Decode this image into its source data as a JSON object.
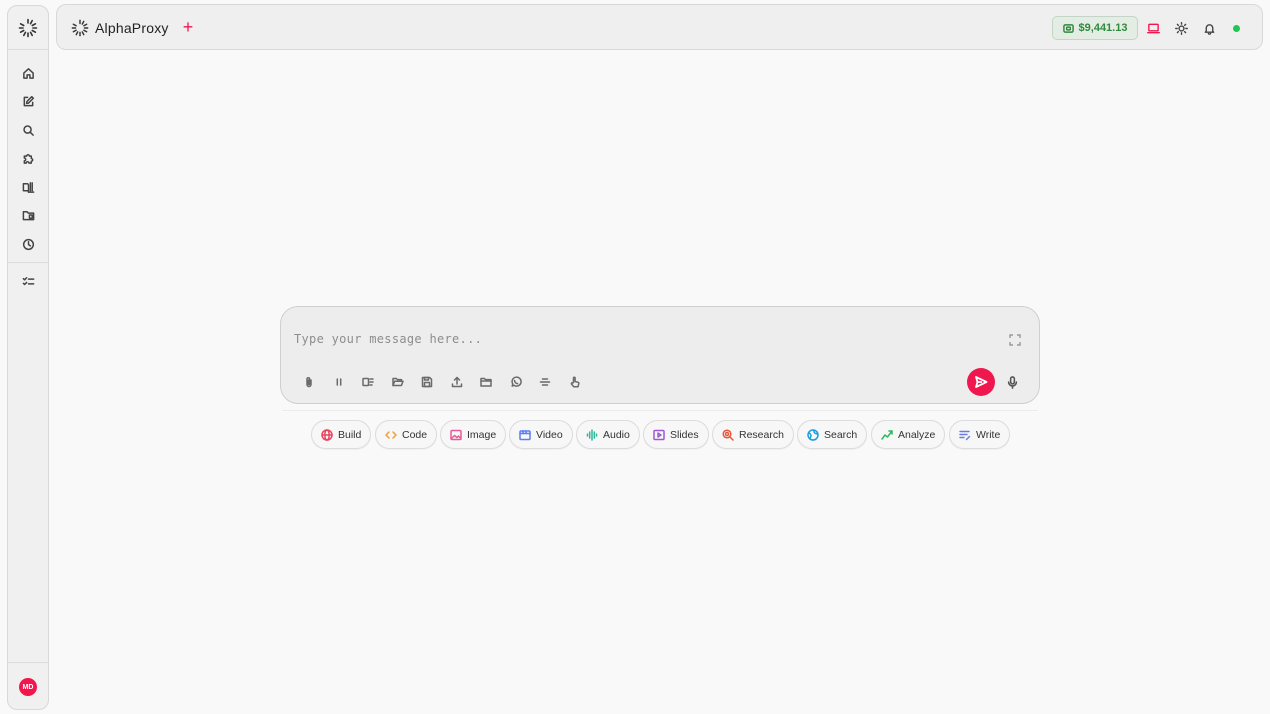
{
  "app": {
    "name": "AlphaProxy",
    "new_label": "+"
  },
  "header": {
    "balance": "$9,441.13"
  },
  "sidebar": {
    "items": [
      {
        "icon": "home-icon"
      },
      {
        "icon": "edit-icon"
      },
      {
        "icon": "search-icon"
      },
      {
        "icon": "puzzle-icon"
      },
      {
        "icon": "library-icon"
      },
      {
        "icon": "folder-icon"
      },
      {
        "icon": "history-icon"
      },
      {
        "icon": "tasks-icon"
      }
    ],
    "avatar": "MD"
  },
  "composer": {
    "placeholder": "Type your message here..."
  },
  "chips": [
    {
      "label": "Build",
      "icon": "globe-icon",
      "color": "#e8455f"
    },
    {
      "label": "Code",
      "icon": "code-icon",
      "color": "#f0a030"
    },
    {
      "label": "Image",
      "icon": "image-icon",
      "color": "#e85a9a"
    },
    {
      "label": "Video",
      "icon": "video-icon",
      "color": "#5b7ef0"
    },
    {
      "label": "Audio",
      "icon": "audio-icon",
      "color": "#2fb89a"
    },
    {
      "label": "Slides",
      "icon": "slides-icon",
      "color": "#9b59d6"
    },
    {
      "label": "Research",
      "icon": "research-icon",
      "color": "#e8553a"
    },
    {
      "label": "Search",
      "icon": "search-globe-icon",
      "color": "#1a9ee0"
    },
    {
      "label": "Analyze",
      "icon": "analyze-icon",
      "color": "#2fb860"
    },
    {
      "label": "Write",
      "icon": "write-icon",
      "color": "#6b7ee0"
    }
  ],
  "colors": {
    "accent": "#f0174e",
    "balance_green": "#2f8a3d",
    "status_online": "#23c552"
  }
}
